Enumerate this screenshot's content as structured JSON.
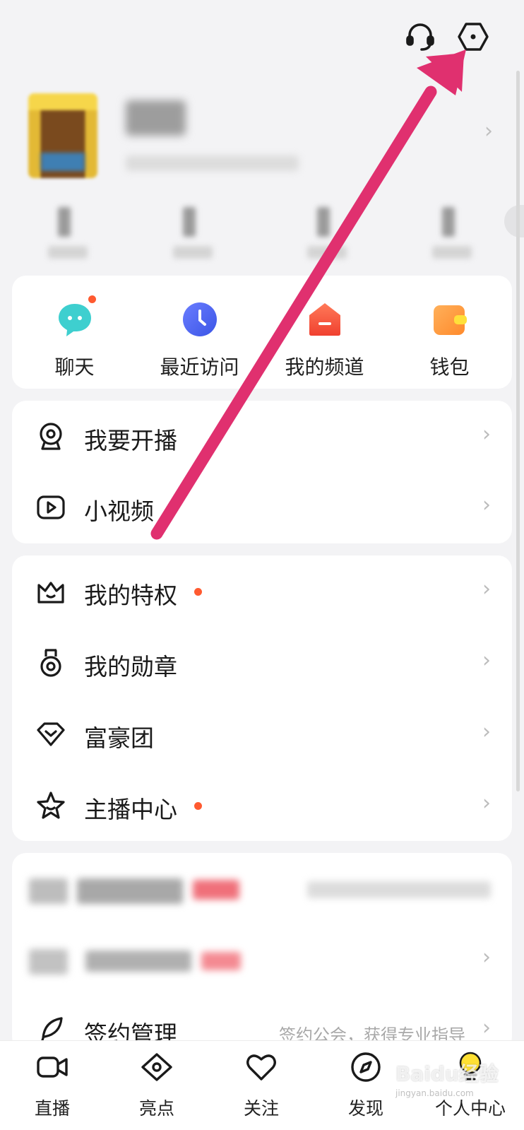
{
  "topbar": {
    "icons": [
      "headset-icon",
      "settings-hexagon-icon"
    ]
  },
  "profile": {
    "chevron": "›"
  },
  "quick_actions": [
    {
      "label": "聊天",
      "icon": "chat-bubble-icon",
      "badge": true
    },
    {
      "label": "最近访问",
      "icon": "clock-icon",
      "badge": false
    },
    {
      "label": "我的频道",
      "icon": "channel-house-icon",
      "badge": false
    },
    {
      "label": "钱包",
      "icon": "wallet-icon",
      "badge": false
    }
  ],
  "menu_group_1": [
    {
      "label": "我要开播",
      "icon": "webcam-icon"
    },
    {
      "label": "小视频",
      "icon": "play-video-icon"
    }
  ],
  "menu_group_2": [
    {
      "label": "我的特权",
      "icon": "crown-icon",
      "dot": true
    },
    {
      "label": "我的勋章",
      "icon": "medal-icon",
      "dot": false
    },
    {
      "label": "富豪团",
      "icon": "diamond-heart-icon",
      "dot": false
    },
    {
      "label": "主播中心",
      "icon": "star-icon",
      "dot": true
    }
  ],
  "menu_group_3": {
    "sign_label": "签约管理",
    "sign_hint": "签约公会，获得专业指导",
    "sign_icon": "feather-icon"
  },
  "chevron": "›",
  "tabs": [
    {
      "label": "直播",
      "icon": "video-camera-icon"
    },
    {
      "label": "亮点",
      "icon": "eye-icon"
    },
    {
      "label": "关注",
      "icon": "heart-icon"
    },
    {
      "label": "发现",
      "icon": "compass-icon"
    },
    {
      "label": "个人中心",
      "icon": "lightbulb-avatar-icon",
      "active": true
    }
  ],
  "watermark": {
    "text": "Baidu经验",
    "sub": "jingyan.baidu.com"
  },
  "colors": {
    "accent_dot": "#ff5a30",
    "arrow": "#e0306f",
    "background": "#f3f3f5",
    "card": "#ffffff"
  }
}
